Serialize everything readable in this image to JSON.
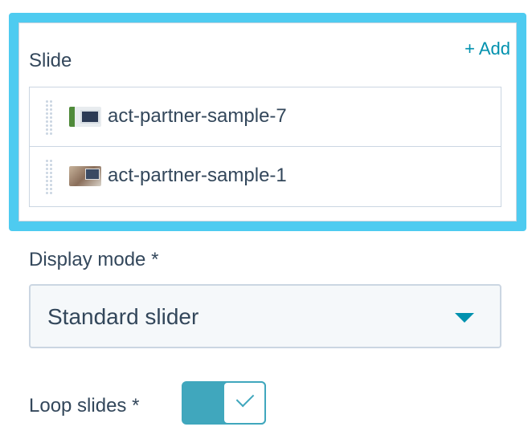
{
  "slides_section": {
    "title": "Slide",
    "add_label": "+ Add",
    "items": [
      {
        "label": "act-partner-sample-7",
        "thumbnail": "desktop-monitor-image"
      },
      {
        "label": "act-partner-sample-1",
        "thumbnail": "office-desk-image"
      }
    ],
    "accent_border_color": "#4ecbf0"
  },
  "display_mode": {
    "label": "Display mode *",
    "selected": "Standard slider"
  },
  "loop_slides": {
    "label": "Loop slides *",
    "enabled": true,
    "toggle_color": "#40a7bd"
  }
}
